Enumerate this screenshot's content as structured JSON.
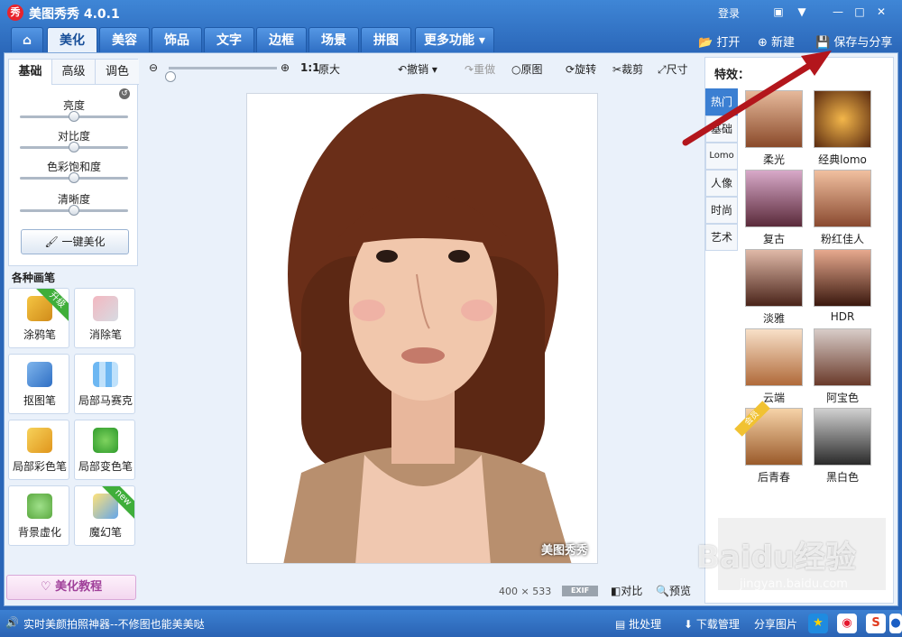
{
  "titlebar": {
    "logo": "秀",
    "title": "美图秀秀 4.0.1",
    "login": "登录"
  },
  "menu": {
    "tabs": [
      {
        "label": "美化",
        "active": true
      },
      {
        "label": "美容"
      },
      {
        "label": "饰品"
      },
      {
        "label": "文字"
      },
      {
        "label": "边框"
      },
      {
        "label": "场景"
      },
      {
        "label": "拼图"
      }
    ],
    "more": "更多功能",
    "open": "打开",
    "new": "新建",
    "save_share": "保存与分享"
  },
  "left": {
    "subtabs": [
      "基础",
      "高级",
      "调色"
    ],
    "sliders": [
      {
        "label": "亮度",
        "value": 0.5
      },
      {
        "label": "对比度",
        "value": 0.5
      },
      {
        "label": "色彩饱和度",
        "value": 0.5
      },
      {
        "label": "清晰度",
        "value": 0.5
      }
    ],
    "one_click": "一键美化",
    "brushes_title": "各种画笔",
    "tools": [
      {
        "label": "涂鸦笔",
        "badge": "升级"
      },
      {
        "label": "消除笔"
      },
      {
        "label": "抠图笔"
      },
      {
        "label": "局部马赛克"
      },
      {
        "label": "局部彩色笔"
      },
      {
        "label": "局部变色笔"
      },
      {
        "label": "背景虚化"
      },
      {
        "label": "魔幻笔",
        "badge": "new"
      }
    ],
    "tutorial": "美化教程"
  },
  "canvas_toolbar": {
    "ratio": "1:1",
    "original_size": "原大",
    "undo": "撤销",
    "redo": "重做",
    "original": "原图",
    "rotate": "旋转",
    "crop": "裁剪",
    "size": "尺寸"
  },
  "canvas": {
    "watermark": "美图秀秀",
    "width": "400",
    "x": "×",
    "height": "533",
    "exif": "EXIF",
    "compare": "对比",
    "preview": "预览"
  },
  "effects": {
    "title": "特效：",
    "tabs": [
      {
        "label": "热门",
        "active": true
      },
      {
        "label": "基础"
      },
      {
        "label": "Lomo"
      },
      {
        "label": "人像"
      },
      {
        "label": "时尚"
      },
      {
        "label": "艺术"
      }
    ],
    "items": [
      {
        "label": "柔光"
      },
      {
        "label": "经典lomo"
      },
      {
        "label": "复古"
      },
      {
        "label": "粉红佳人"
      },
      {
        "label": "淡雅"
      },
      {
        "label": "HDR"
      },
      {
        "label": "云端"
      },
      {
        "label": "阿宝色"
      },
      {
        "label": "后青春",
        "badge": "会员"
      },
      {
        "label": "黑白色"
      }
    ]
  },
  "statusbar": {
    "promo": "实时美颜拍照神器--不修图也能美美哒",
    "batch": "批处理",
    "download": "下载管理",
    "share": "分享图片"
  },
  "overlay": {
    "watermark": "Baidu经验",
    "watermark_sub": "jingyan.baidu.com"
  },
  "colors": {
    "accent": "#2a66b8",
    "annotation": "#b3161c"
  }
}
